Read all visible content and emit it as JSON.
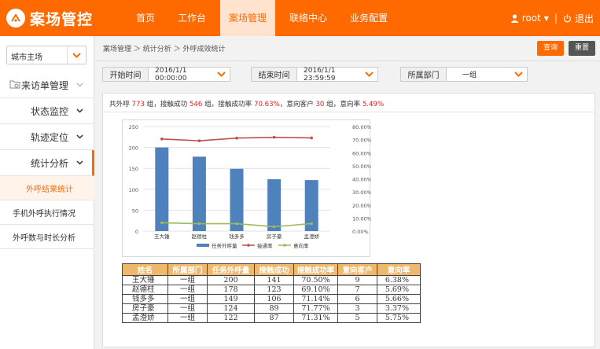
{
  "app": {
    "logo_text": "案场管控",
    "nav": [
      "首页",
      "工作台",
      "案场管理",
      "联络中心",
      "业务配置"
    ],
    "active_nav": 2,
    "user": "root",
    "logout": "退出"
  },
  "colors": {
    "brand": "#ff6a00",
    "bar": "#4f81bd",
    "line_rate": "#c0504d",
    "line_intent": "#9bbb59"
  },
  "sidebar": {
    "city_select": "城市主场",
    "items": [
      {
        "label": "来访单管理"
      },
      {
        "label": "状态监控"
      },
      {
        "label": "轨迹定位"
      },
      {
        "label": "统计分析"
      }
    ],
    "subitems": [
      {
        "label": "外呼结果统计"
      },
      {
        "label": "手机外呼执行情况"
      },
      {
        "label": "外呼数与时长分析"
      }
    ]
  },
  "breadcrumb": "案场管理 ＞ 统计分析 ＞ 外呼成效统计",
  "toolbar": {
    "query": "查询",
    "reset": "重置"
  },
  "filters": {
    "start_label": "开始时间",
    "start_value": "2016/1/1 00:00:00",
    "end_label": "结束时间",
    "end_value": "2016/1/1 23:59:59",
    "dept_label": "所属部门",
    "dept_value": "一组"
  },
  "summary": {
    "p1": "共外呼 ",
    "total": "773",
    "p2": " 组，接触成功 ",
    "success": "546",
    "p3": " 组，接触成功率 ",
    "rate": "70.63%",
    "p4": "，意向客户 ",
    "intent": "30",
    "p5": " 组，意向率 ",
    "intent_rate": "5.49%"
  },
  "chart_data": {
    "type": "bar",
    "categories": [
      "王大锤",
      "赵德柱",
      "钱多多",
      "房子豪",
      "孟澄娇"
    ],
    "series": [
      {
        "name": "任务外呼量",
        "type": "bar",
        "axis": "left",
        "values": [
          200,
          178,
          149,
          124,
          122
        ]
      },
      {
        "name": "接通率",
        "type": "line",
        "axis": "right",
        "values": [
          70.5,
          69.1,
          71.14,
          71.77,
          71.31
        ]
      },
      {
        "name": "意向率",
        "type": "line",
        "axis": "right",
        "values": [
          6.38,
          5.69,
          5.66,
          3.37,
          5.75
        ]
      }
    ],
    "ylim": [
      0,
      250
    ],
    "yticks": [
      "0",
      "50",
      "100",
      "150",
      "200",
      "250"
    ],
    "y2lim": [
      0,
      80
    ],
    "y2ticks": [
      "0.00%",
      "10.00%",
      "20.00%",
      "30.00%",
      "40.00%",
      "50.00%",
      "60.00%",
      "70.00%",
      "80.00%"
    ],
    "grid": true,
    "legend": "bottom"
  },
  "table": {
    "headers": [
      "姓名",
      "所属部门",
      "任务外呼量",
      "接触成功",
      "接触成功率",
      "意向客户",
      "意向率"
    ],
    "rows": [
      [
        "王大锤",
        "一组",
        "200",
        "141",
        "70.50%",
        "9",
        "6.38%"
      ],
      [
        "赵德柱",
        "一组",
        "178",
        "123",
        "69.10%",
        "7",
        "5.69%"
      ],
      [
        "钱多多",
        "一组",
        "149",
        "106",
        "71.14%",
        "6",
        "5.66%"
      ],
      [
        "房子豪",
        "一组",
        "124",
        "89",
        "71.77%",
        "3",
        "3.37%"
      ],
      [
        "孟澄娇",
        "一组",
        "122",
        "87",
        "71.31%",
        "5",
        "5.75%"
      ]
    ]
  }
}
